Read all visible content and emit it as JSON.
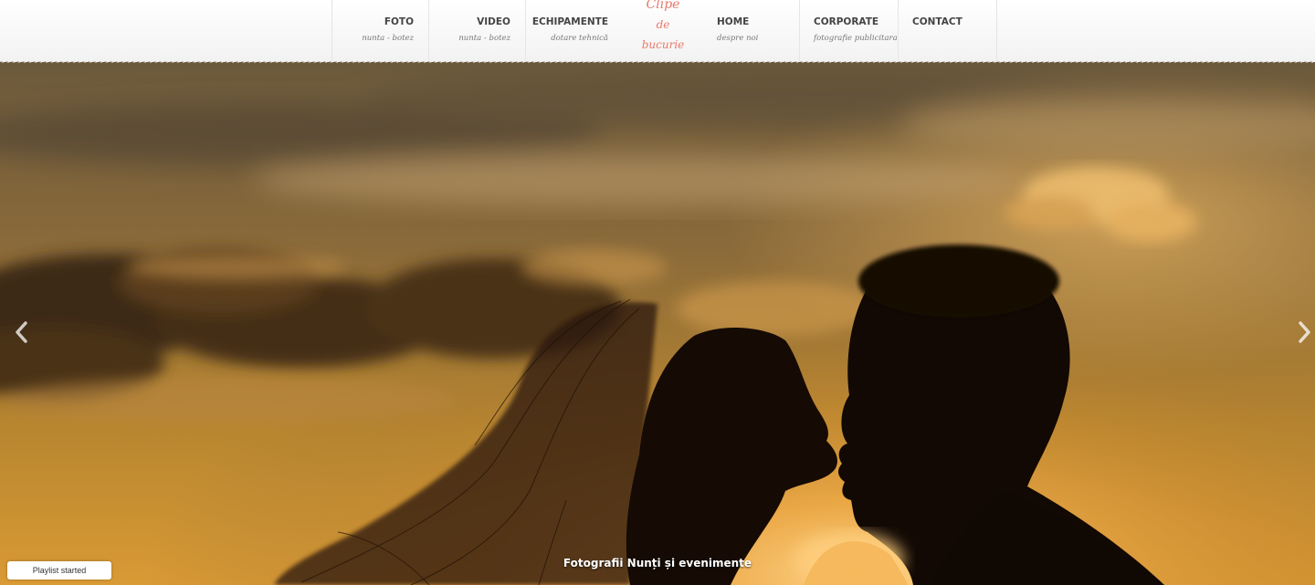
{
  "nav": {
    "items": [
      {
        "title": "FOTO",
        "sub": "nunta - botez"
      },
      {
        "title": "VIDEO",
        "sub": "nunta - botez"
      },
      {
        "title": "ECHIPAMENTE",
        "sub": "dotare tehnică"
      },
      {
        "title": "HOME",
        "sub": "despre noi"
      },
      {
        "title": "CORPORATE",
        "sub": "fotografie publicitara"
      },
      {
        "title": "CONTACT",
        "sub": ""
      }
    ]
  },
  "logo": {
    "line1": "Clipe",
    "line2": "de",
    "line3": "bucurie"
  },
  "slider": {
    "caption": "Fotografii Nunți și evenimente",
    "prev_icon": "chevron-left-icon",
    "next_icon": "chevron-right-icon"
  },
  "toast": {
    "text": "Playlist started"
  },
  "colors": {
    "logo": "#e8786a",
    "nav_text": "#444444",
    "nav_sub": "#777777",
    "sky_top": "#6a5638",
    "sky_glow": "#e6ab4d"
  }
}
